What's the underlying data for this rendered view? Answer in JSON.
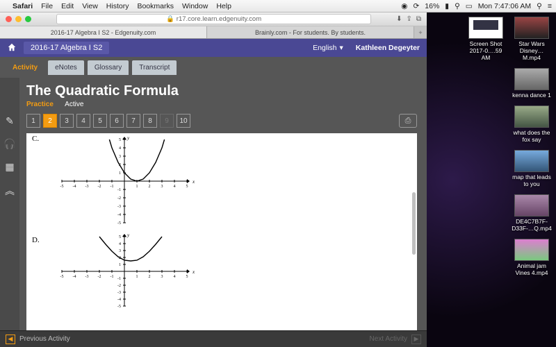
{
  "menubar": {
    "app": "Safari",
    "items": [
      "File",
      "Edit",
      "View",
      "History",
      "Bookmarks",
      "Window",
      "Help"
    ],
    "battery": "16%",
    "clock": "Mon 7:47:06 AM"
  },
  "window": {
    "url": "r17.core.learn.edgenuity.com",
    "tabs": [
      "2016-17 Algebra I S2 - Edgenuity.com",
      "Brainly.com - For students. By students."
    ],
    "newtab": "+"
  },
  "edg": {
    "course": "2016-17 Algebra I S2",
    "language": "English",
    "user": "Kathleen Degeyter",
    "nav_tabs": [
      "Activity",
      "eNotes",
      "Glossary",
      "Transcript"
    ],
    "title": "The Quadratic Formula",
    "mode_a": "Practice",
    "mode_b": "Active",
    "questions": [
      "1",
      "2",
      "3",
      "4",
      "5",
      "6",
      "7",
      "8",
      "9",
      "10"
    ],
    "current_q": 1,
    "options": {
      "c": "C.",
      "d": "D."
    },
    "footer_prev": "Previous Activity",
    "footer_next": "Next Activity"
  },
  "desktop": {
    "col1": [
      {
        "label": "Screen Shot 2017-0….59 AM",
        "cls": "ss"
      }
    ],
    "col2": [
      {
        "label": "Star Wars Disney…M.mp4",
        "cls": "v1"
      },
      {
        "label": "kenna dance 1",
        "cls": "v2"
      },
      {
        "label": "what does the fox say",
        "cls": "v3"
      },
      {
        "label": "map that leads to you",
        "cls": "v4"
      },
      {
        "label": "DE4C7B7F-D33F-…Q.mp4",
        "cls": "v5"
      },
      {
        "label": "Animal jam Vines 4.mp4",
        "cls": "v6"
      }
    ]
  },
  "chart_data": [
    {
      "type": "line",
      "label": "C",
      "description": "Upward parabola, vertex near (1,0), opening upward",
      "xlim": [
        -5,
        5
      ],
      "ylim": [
        -5,
        5
      ],
      "x": [
        -1.2,
        -1,
        -0.5,
        0,
        0.5,
        1,
        1.5,
        2,
        2.5,
        3,
        3.2
      ],
      "y": [
        5,
        4,
        2.25,
        1,
        0.25,
        0,
        0.25,
        1,
        2.25,
        4,
        5
      ]
    },
    {
      "type": "line",
      "label": "D",
      "description": "Upward parabola, vertex near (0.5,1.5), opening upward",
      "xlim": [
        -5,
        5
      ],
      "ylim": [
        -5,
        5
      ],
      "x": [
        -2,
        -1.5,
        -1,
        -0.5,
        0,
        0.5,
        1,
        1.5,
        2,
        2.5,
        3
      ],
      "y": [
        5,
        3.9,
        2.9,
        2.1,
        1.6,
        1.5,
        1.6,
        2.1,
        2.9,
        3.9,
        5
      ]
    }
  ]
}
